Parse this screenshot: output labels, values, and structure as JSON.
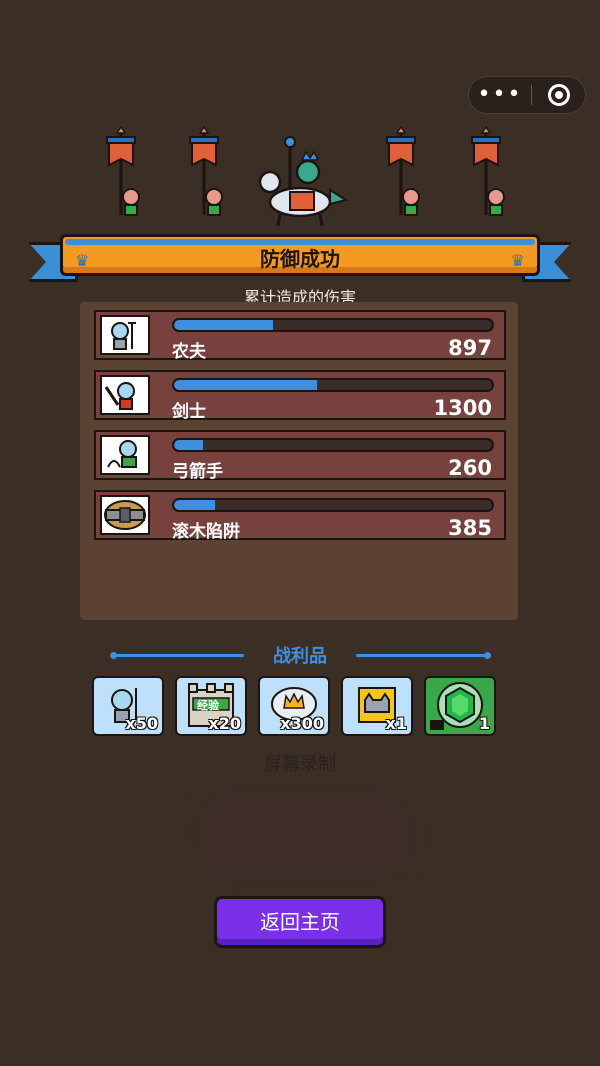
{
  "capsule": {
    "more_icon": "more-dots-icon",
    "record_icon": "record-circle-icon"
  },
  "banner": {
    "title": "防御成功",
    "icon": "crown-icon"
  },
  "damage": {
    "subtitle": "累计造成的伤害",
    "rows": [
      {
        "name": "农夫",
        "value": "897",
        "progress": 0.31,
        "icon": "farmer-icon"
      },
      {
        "name": "剑士",
        "value": "1300",
        "progress": 0.45,
        "icon": "swordsman-icon"
      },
      {
        "name": "弓箭手",
        "value": "260",
        "progress": 0.09,
        "icon": "archer-icon"
      },
      {
        "name": "滚木陷阱",
        "value": "385",
        "progress": 0.13,
        "icon": "rolling-log-trap-icon"
      }
    ]
  },
  "loot": {
    "title": "战利品",
    "items": [
      {
        "icon": "farmer-icon",
        "count": "x50"
      },
      {
        "icon": "castle-exp-icon",
        "label": "经验",
        "count": "x20"
      },
      {
        "icon": "crown-coin-icon",
        "count": "x300"
      },
      {
        "icon": "horned-helmet-icon",
        "count": "x1"
      },
      {
        "icon": "green-gem-icon",
        "count": "1"
      }
    ]
  },
  "record_label": "屏幕录制",
  "home_button": "返回主页",
  "colors": {
    "accent": "#3f8fe0",
    "ribbon": "#f39a22",
    "button": "#7a2fe8",
    "background": "#3b2e25"
  }
}
